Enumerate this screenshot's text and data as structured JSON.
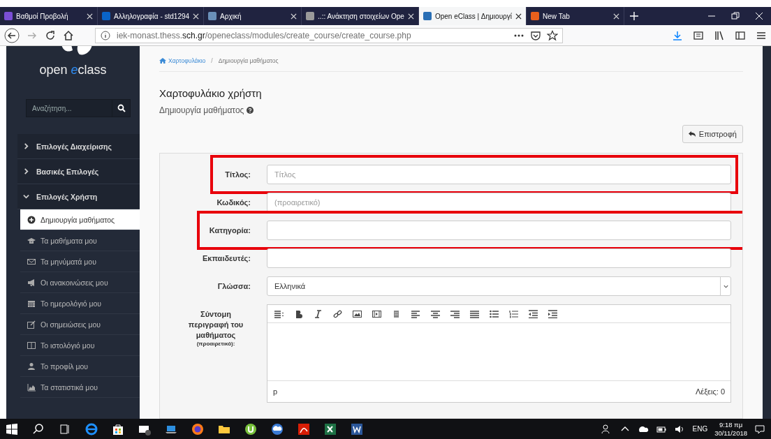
{
  "browser": {
    "tabs": [
      {
        "label": "Βαθμοί Προβολή",
        "selected": false,
        "color": "#7b4fd6"
      },
      {
        "label": "Αλληλογραφία - std1294",
        "selected": false,
        "color": "#0a64c8"
      },
      {
        "label": "Αρχική",
        "selected": false,
        "color": "#6a8fb8"
      },
      {
        "label": "..:: Ανάκτηση στοιχείων Ope",
        "selected": false,
        "color": "#9a9a9a"
      },
      {
        "label": "Open eClass | Δημιουργί",
        "selected": true,
        "color": "#2a6fb5"
      },
      {
        "label": "New Tab",
        "selected": false,
        "color": "#e8601c"
      }
    ],
    "url_prefix": "iek-monast.thess.",
    "url_domain": "sch.gr",
    "url_path": "/openeclass/modules/create_course/create_course.php"
  },
  "sidebar": {
    "logo_open": "open ",
    "logo_e": "e",
    "logo_class": "class",
    "search": {
      "placeholder": "Αναζήτηση..."
    },
    "groups": [
      {
        "label": "Επιλογές Διαχείρισης",
        "expanded": false
      },
      {
        "label": "Βασικές Επιλογές",
        "expanded": false
      },
      {
        "label": "Επιλογές Χρήστη",
        "expanded": true
      }
    ],
    "items": [
      {
        "label": "Δημιουργία μαθήματος",
        "kind": "plus",
        "selected": true
      },
      {
        "label": "Τα μαθήματα μου",
        "kind": "cap",
        "selected": false
      },
      {
        "label": "Τα μηνύματά μου",
        "kind": "mail",
        "selected": false
      },
      {
        "label": "Οι ανακοινώσεις μου",
        "kind": "bullhorn",
        "selected": false
      },
      {
        "label": "Το ημερολόγιό μου",
        "kind": "calendar",
        "selected": false
      },
      {
        "label": "Οι σημειώσεις μου",
        "kind": "note",
        "selected": false
      },
      {
        "label": "Το ιστολόγιό μου",
        "kind": "columns",
        "selected": false
      },
      {
        "label": "Το προφίλ μου",
        "kind": "user",
        "selected": false
      },
      {
        "label": "Τα στατιστικά μου",
        "kind": "chart",
        "selected": false
      }
    ]
  },
  "breadcrumb": [
    {
      "label": "Χαρτοφυλάκιο"
    },
    {
      "separator": "/",
      "label": "Δημιουργία μαθήματος"
    }
  ],
  "page_title": "Χαρτοφυλάκιο χρήστη",
  "page_subtitle": "Δημιουργία μαθήματος",
  "back_button": "Επιστροφή",
  "form": [
    {
      "kind": "text",
      "label": "Τίτλος:",
      "placeholder": "Τίτλος",
      "highlighted": true
    },
    {
      "kind": "text",
      "label": "Κωδικός:",
      "placeholder": "(προαιρετικό)",
      "highlighted": false
    },
    {
      "kind": "text",
      "label": "Κατηγορία:",
      "highlighted": true
    },
    {
      "kind": "text",
      "label": "Εκπαιδευτές:",
      "highlighted": false
    },
    {
      "kind": "select",
      "label": "Γλώσσα:",
      "value": "Ελληνικά",
      "highlighted": false
    },
    {
      "kind": "editor",
      "label": "Σύντομη περιγραφή του μαθήματος",
      "note": "(προαιρετικό):",
      "path": "p",
      "word_count": "Λέξεις: 0",
      "highlighted": false
    }
  ],
  "taskbar": {
    "lang": "ENG",
    "time": "9:18 πμ",
    "date": "30/11/2018"
  }
}
